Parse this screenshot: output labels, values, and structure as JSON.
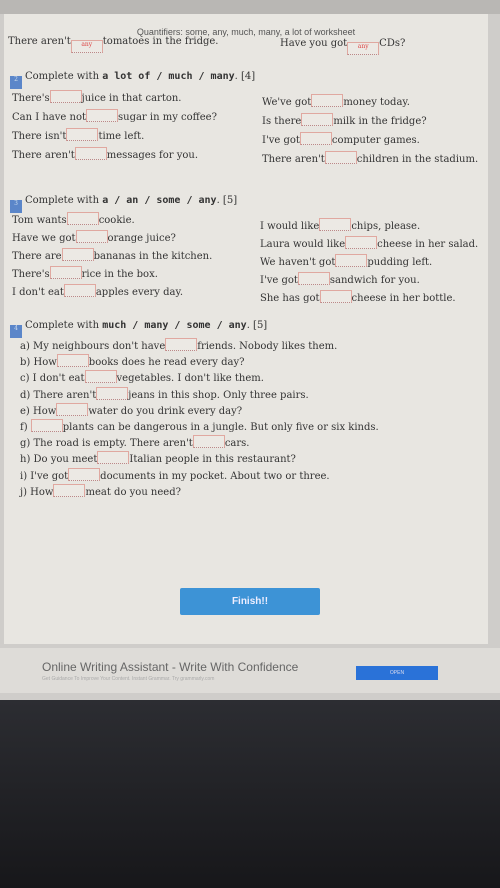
{
  "title": "Quantifiers: some, any, much, many, a lot of worksheet",
  "examples": [
    {
      "before": "There aren't",
      "answer": "any",
      "after": "tomatoes in the fridge."
    },
    {
      "before": "Have you got",
      "answer": "any",
      "after": "CDs?"
    }
  ],
  "sections": [
    {
      "number": "2",
      "prefix": "Complete with ",
      "bold": "a lot of / much / many",
      "suffix": ". [4]",
      "left": [
        {
          "before": "There's",
          "after": "juice in that carton."
        },
        {
          "before": "Can I have not",
          "after": "sugar in my coffee?"
        },
        {
          "before": "There isn't",
          "after": "time left."
        },
        {
          "before": "There aren't",
          "after": "messages for you."
        }
      ],
      "right": [
        {
          "before": "We've got",
          "after": "money today."
        },
        {
          "before": "Is there",
          "after": "milk in the fridge?"
        },
        {
          "before": "I've got",
          "after": "computer games."
        },
        {
          "before": "There aren't",
          "after": "children in the stadium."
        }
      ]
    },
    {
      "number": "3",
      "prefix": "Complete with ",
      "bold": "a / an / some / any",
      "suffix": ". [5]",
      "left": [
        {
          "before": "Tom wants",
          "after": "cookie."
        },
        {
          "before": "Have we got",
          "after": "orange juice?"
        },
        {
          "before": "There are",
          "after": "bananas in the kitchen."
        },
        {
          "before": "There's",
          "after": "rice in the box."
        },
        {
          "before": "I don't eat",
          "after": "apples every day."
        }
      ],
      "right": [
        {
          "before": "I would like",
          "after": "chips, please."
        },
        {
          "before": "Laura would like",
          "after": "cheese in her salad."
        },
        {
          "before": "We haven't got",
          "after": "pudding left."
        },
        {
          "before": "I've got",
          "after": "sandwich for you."
        },
        {
          "before": "She has got",
          "after": "cheese in her bottle."
        }
      ]
    },
    {
      "number": "4",
      "prefix": "Complete with ",
      "bold": "much / many / some / any",
      "suffix": ". [5]",
      "left": [
        {
          "before": "a)  My neighbours don't have",
          "after": "friends. Nobody likes them."
        },
        {
          "before": "b)  How",
          "after": "books does he read every day?"
        },
        {
          "before": "c)  I don't eat",
          "after": "vegetables. I don't like them."
        },
        {
          "before": "d)  There aren't",
          "after": "jeans in this shop. Only three pairs."
        },
        {
          "before": "e)  How",
          "after": "water do you drink every day?"
        },
        {
          "before": "f)  ",
          "after": "plants can be dangerous in a jungle. But only five or six kinds."
        },
        {
          "before": "g)  The road is empty. There aren't",
          "after": "cars."
        },
        {
          "before": "h)  Do you meet",
          "after": "Italian people in this restaurant?"
        },
        {
          "before": "i)  I've got",
          "after": "documents in my pocket. About two or three."
        },
        {
          "before": "j)  How",
          "after": "meat do you need?"
        }
      ],
      "right": []
    }
  ],
  "finish_label": "Finish!!",
  "ad": {
    "headline": "Online Writing Assistant - Write With Confidence",
    "subtext": "Get Guidance To Improve Your Content. Instant Grammar. Try grammarly.com",
    "button": "OPEN"
  }
}
